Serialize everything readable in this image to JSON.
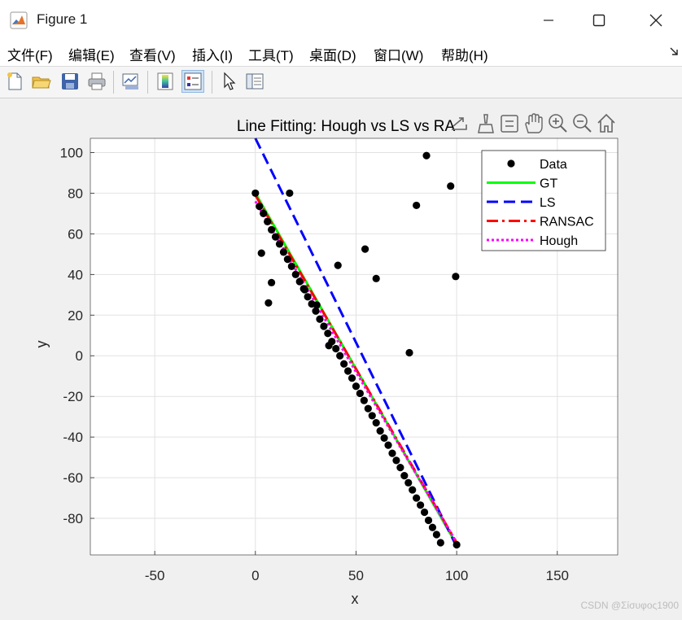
{
  "window": {
    "title": "Figure 1",
    "app_icon": "matlab-icon",
    "controls": [
      "minimize-icon",
      "maximize-icon",
      "close-icon"
    ]
  },
  "menu": {
    "items": [
      "文件(F)",
      "编辑(E)",
      "查看(V)",
      "插入(I)",
      "工具(T)",
      "桌面(D)",
      "窗口(W)",
      "帮助(H)"
    ],
    "overflow_icon": "dock-arrow-icon"
  },
  "toolbar": {
    "buttons": [
      "new-figure-icon",
      "open-file-icon",
      "save-icon",
      "print-icon",
      "link-plot-icon",
      "colorbar-icon",
      "legend-icon",
      "edit-plot-icon",
      "property-inspector-icon"
    ]
  },
  "axes_toolbar": [
    "export-icon",
    "brush-icon",
    "datatip-icon",
    "pan-hand-icon",
    "zoom-in-icon",
    "zoom-out-icon",
    "home-icon"
  ],
  "chart_data": {
    "type": "line",
    "title": "Line Fitting: Hough vs LS vs RA",
    "xlabel": "x",
    "ylabel": "y",
    "xlim": [
      -82,
      180
    ],
    "ylim": [
      -98,
      107
    ],
    "xticks": [
      -50,
      0,
      50,
      100,
      150
    ],
    "yticks": [
      100,
      80,
      60,
      40,
      20,
      0,
      -20,
      -40,
      -60,
      -80
    ],
    "grid": true,
    "legend_position": "top-right",
    "legend": [
      "Data",
      "GT",
      "LS",
      "RANSAC",
      "Hough"
    ],
    "series": [
      {
        "name": "Data",
        "style": "markers",
        "color": "#000000",
        "points": [
          [
            0,
            80
          ],
          [
            2,
            73.5
          ],
          [
            4,
            70
          ],
          [
            6,
            66
          ],
          [
            8,
            62
          ],
          [
            10,
            58.5
          ],
          [
            12,
            55
          ],
          [
            14,
            51
          ],
          [
            16,
            47.5
          ],
          [
            18,
            44
          ],
          [
            20,
            40
          ],
          [
            22,
            36.5
          ],
          [
            24,
            33
          ],
          [
            26,
            29
          ],
          [
            28,
            25.5
          ],
          [
            30,
            22
          ],
          [
            32,
            18
          ],
          [
            34,
            14.5
          ],
          [
            36,
            11
          ],
          [
            38,
            7
          ],
          [
            40,
            3.5
          ],
          [
            42,
            0
          ],
          [
            44,
            -4
          ],
          [
            46,
            -7.5
          ],
          [
            48,
            -11
          ],
          [
            50,
            -15
          ],
          [
            52,
            -18.5
          ],
          [
            54,
            -22
          ],
          [
            56,
            -26
          ],
          [
            58,
            -29.5
          ],
          [
            60,
            -33
          ],
          [
            62,
            -37
          ],
          [
            64,
            -40.5
          ],
          [
            66,
            -44
          ],
          [
            68,
            -48
          ],
          [
            70,
            -51.5
          ],
          [
            72,
            -55
          ],
          [
            74,
            -59
          ],
          [
            76,
            -62.5
          ],
          [
            78,
            -66
          ],
          [
            80,
            -70
          ],
          [
            82,
            -73.5
          ],
          [
            84,
            -77
          ],
          [
            86,
            -81
          ],
          [
            88,
            -84.5
          ],
          [
            90,
            -88
          ],
          [
            92,
            -92
          ],
          [
            100,
            -93
          ],
          [
            3,
            50.5
          ],
          [
            6.5,
            26
          ],
          [
            8,
            36
          ],
          [
            17,
            80
          ],
          [
            24.5,
            32.5
          ],
          [
            30.5,
            25
          ],
          [
            36.5,
            5
          ],
          [
            41,
            44.5
          ],
          [
            54.5,
            52.5
          ],
          [
            60,
            38
          ],
          [
            76.5,
            1.5
          ],
          [
            80,
            74
          ],
          [
            85,
            98.5
          ],
          [
            97,
            83.5
          ],
          [
            99.5,
            39
          ]
        ]
      },
      {
        "name": "GT",
        "style": "solid",
        "color": "#00ff00",
        "x": [
          0,
          100
        ],
        "y": [
          80,
          -93
        ]
      },
      {
        "name": "LS",
        "style": "dashed",
        "color": "#0000ff",
        "x": [
          0,
          100
        ],
        "y": [
          107,
          -94
        ]
      },
      {
        "name": "RANSAC",
        "style": "dashdot",
        "color": "#ff0000",
        "x": [
          0,
          100
        ],
        "y": [
          79,
          -92
        ]
      },
      {
        "name": "Hough",
        "style": "dotted",
        "color": "#ff00ff",
        "x": [
          0,
          100
        ],
        "y": [
          76,
          -92
        ]
      }
    ]
  },
  "watermark": "CSDN @Σίσυφος1900"
}
